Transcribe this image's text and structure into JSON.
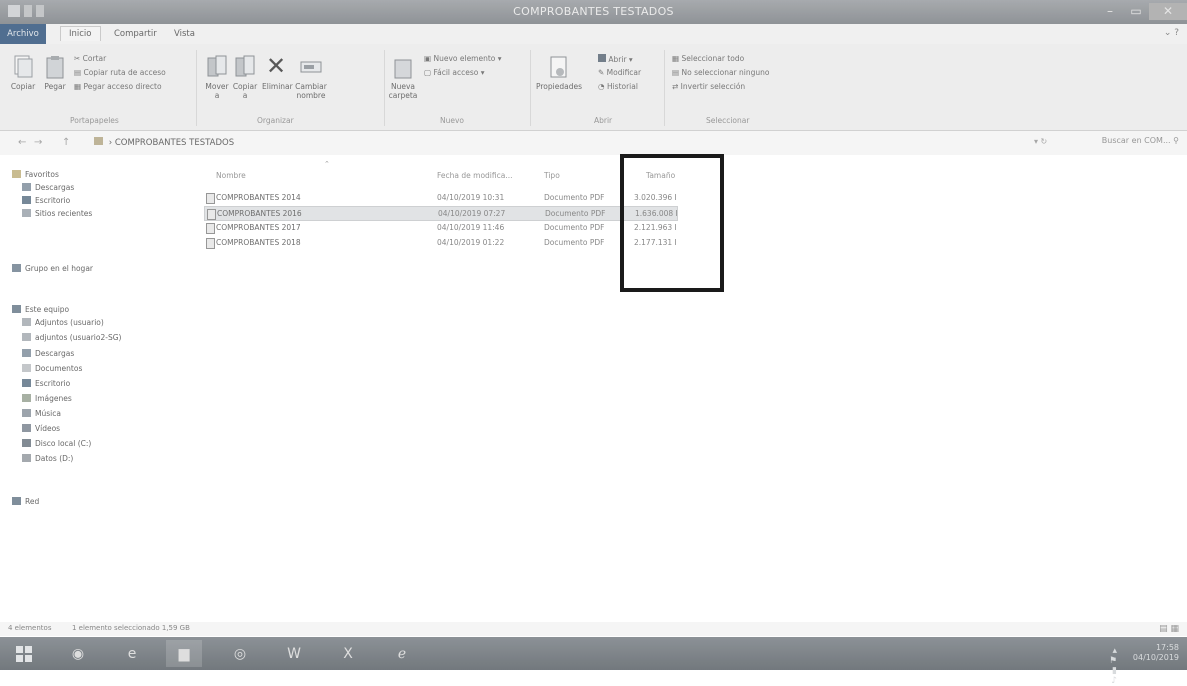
{
  "window": {
    "title": "COMPROBANTES TESTADOS",
    "controls": [
      "–",
      "▭",
      "✕"
    ]
  },
  "ribbon_tabs": [
    "Archivo",
    "Inicio",
    "Compartir",
    "Vista"
  ],
  "ribbon": {
    "portapapeles": {
      "copy": "Copiar",
      "paste": "Pegar",
      "cut": "Cortar",
      "copy_path": "Copiar ruta de acceso",
      "paste_shortcut": "Pegar acceso directo",
      "label": "Portapapeles"
    },
    "organizar": {
      "move": "Mover a",
      "copy_to": "Copiar a",
      "delete": "Eliminar",
      "rename": "Cambiar nombre",
      "label": "Organizar"
    },
    "nuevo": {
      "new_folder": "Nueva carpeta",
      "new_item": "Nuevo elemento",
      "easy_access": "Fácil acceso",
      "label": "Nuevo"
    },
    "abrir": {
      "properties": "Propiedades",
      "open": "Abrir",
      "edit": "Modificar",
      "history": "Historial",
      "label": "Abrir"
    },
    "seleccionar": {
      "select_all": "Seleccionar todo",
      "select_none": "No seleccionar ninguno",
      "invert": "Invertir selección",
      "label": "Seleccionar"
    }
  },
  "address": {
    "path": "COMPROBANTES TESTADOS",
    "search_placeholder": "Buscar en COM..."
  },
  "nav": {
    "favoritos": "Favoritos",
    "fav_items": [
      "Descargas",
      "Escritorio",
      "Sitios recientes"
    ],
    "grupo_hogar": "Grupo en el hogar",
    "este_equipo": "Este equipo",
    "equipo_items": [
      "Adjuntos (usuario)",
      "adjuntos (usuario2-SG)",
      "Descargas",
      "Documentos",
      "Escritorio",
      "Imágenes",
      "Música",
      "Vídeos",
      "Disco local (C:)",
      "Datos (D:)"
    ],
    "red": "Red"
  },
  "columns": {
    "name": "Nombre",
    "date": "Fecha de modifica...",
    "type": "Tipo",
    "size": "Tamaño"
  },
  "files": [
    {
      "name": "COMPROBANTES 2014",
      "date": "04/10/2019 10:31",
      "type": "Documento PDF",
      "size": "3.020.396 KB"
    },
    {
      "name": "COMPROBANTES 2016",
      "date": "04/10/2019 07:27",
      "type": "Documento PDF",
      "size": "1.636.008 KB"
    },
    {
      "name": "COMPROBANTES 2017",
      "date": "04/10/2019 11:46",
      "type": "Documento PDF",
      "size": "2.121.963 KB"
    },
    {
      "name": "COMPROBANTES 2018",
      "date": "04/10/2019 01:22",
      "type": "Documento PDF",
      "size": "2.177.131 KB"
    }
  ],
  "status": {
    "items": "4 elementos",
    "selection": "1 elemento seleccionado  1,59 GB"
  },
  "taskbar": {
    "time": "17:58",
    "date": "04/10/2019"
  }
}
